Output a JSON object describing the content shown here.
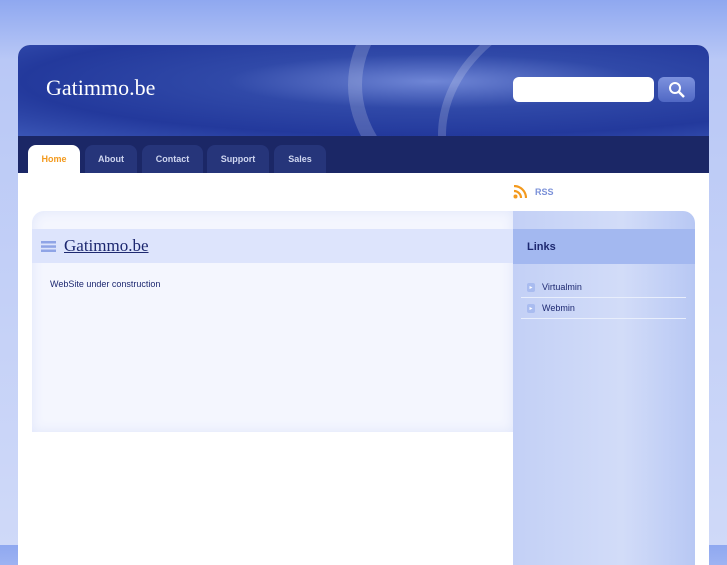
{
  "header": {
    "site_title": "Gatimmo.be",
    "search_placeholder": ""
  },
  "nav": {
    "tabs": [
      {
        "label": "Home",
        "active": true
      },
      {
        "label": "About"
      },
      {
        "label": "Contact"
      },
      {
        "label": "Support"
      },
      {
        "label": "Sales"
      }
    ]
  },
  "rss": {
    "label": "RSS"
  },
  "main": {
    "title": "Gatimmo.be",
    "text": "WebSite under construction"
  },
  "sidebar": {
    "heading": "Links",
    "links": [
      {
        "label": "Virtualmin"
      },
      {
        "label": "Webmin"
      }
    ]
  },
  "colors": {
    "accent": "#f39a1e",
    "nav": "#1b2766",
    "header": "#23399c"
  }
}
